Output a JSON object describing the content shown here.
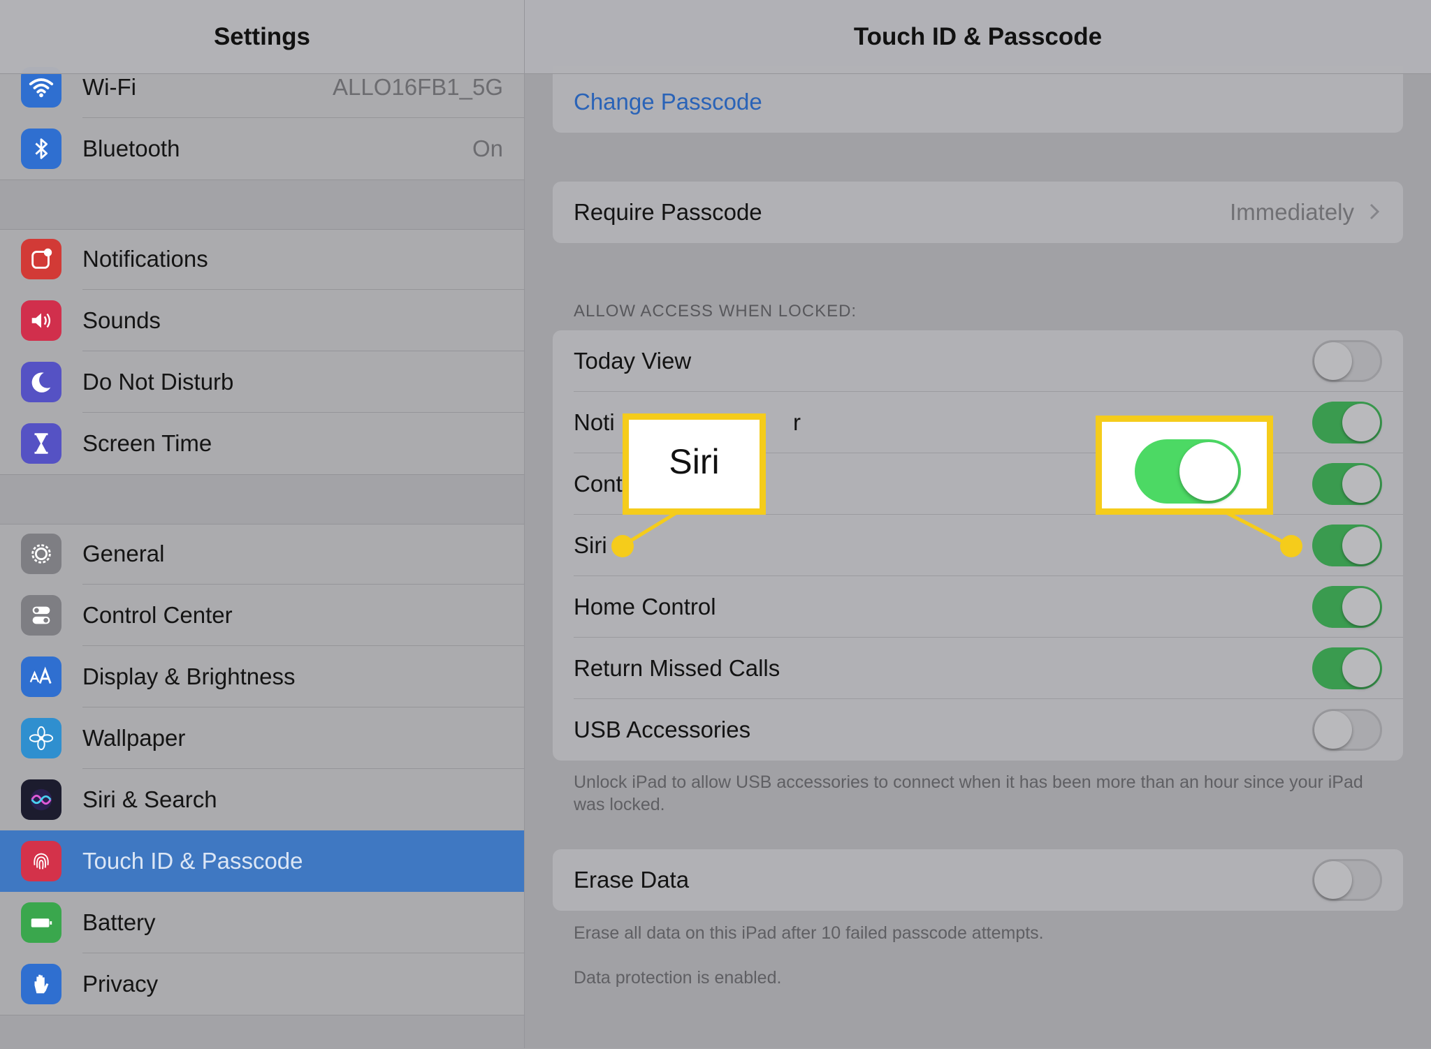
{
  "sidebar": {
    "title": "Settings",
    "items": [
      {
        "label": "Wi-Fi",
        "value": "ALLO16FB1_5G",
        "icon": "wifi-icon",
        "color": "#2f6fd0"
      },
      {
        "label": "Bluetooth",
        "value": "On",
        "icon": "bluetooth-icon",
        "color": "#2f6fd0"
      },
      {
        "label": "Notifications",
        "icon": "notifications-icon",
        "color": "#d23a36"
      },
      {
        "label": "Sounds",
        "icon": "speaker-icon",
        "color": "#d12f4c"
      },
      {
        "label": "Do Not Disturb",
        "icon": "moon-icon",
        "color": "#5552c4"
      },
      {
        "label": "Screen Time",
        "icon": "hourglass-icon",
        "color": "#5552c4"
      },
      {
        "label": "General",
        "icon": "gear-icon",
        "color": "#7e7e83"
      },
      {
        "label": "Control Center",
        "icon": "switches-icon",
        "color": "#7e7e83"
      },
      {
        "label": "Display & Brightness",
        "icon": "text-size-icon",
        "color": "#2f6fd0"
      },
      {
        "label": "Wallpaper",
        "icon": "flower-icon",
        "color": "#2f8fcf"
      },
      {
        "label": "Siri & Search",
        "icon": "siri-icon",
        "color": "#1c1c2e"
      },
      {
        "label": "Touch ID & Passcode",
        "icon": "fingerprint-icon",
        "color": "#d4324a",
        "selected": true
      },
      {
        "label": "Battery",
        "icon": "battery-icon",
        "color": "#3aa74d"
      },
      {
        "label": "Privacy",
        "icon": "hand-icon",
        "color": "#2f6fd0"
      }
    ]
  },
  "main": {
    "title": "Touch ID & Passcode",
    "change_passcode": "Change Passcode",
    "require_passcode": {
      "label": "Require Passcode",
      "value": "Immediately"
    },
    "section_header": "ALLOW ACCESS WHEN LOCKED:",
    "access_rows": [
      {
        "label": "Today View",
        "on": false
      },
      {
        "label": "Noti",
        "on": true
      },
      {
        "label": "Cont",
        "on": true
      },
      {
        "label": "Siri",
        "on": true
      },
      {
        "label": "Home Control",
        "on": true
      },
      {
        "label": "Return Missed Calls",
        "on": true
      },
      {
        "label": "USB Accessories",
        "on": false
      }
    ],
    "notif_trailing": "r",
    "usb_footer": "Unlock iPad to allow USB accessories to connect when it has been more than an hour since your iPad was locked.",
    "erase_data": {
      "label": "Erase Data",
      "on": false
    },
    "erase_footer": "Erase all data on this iPad after 10 failed passcode attempts.",
    "protection_footer": "Data protection is enabled."
  },
  "callouts": {
    "siri_label": "Siri",
    "accent_color": "#f5cc1b",
    "toggle_on_color": "#4cd964"
  }
}
